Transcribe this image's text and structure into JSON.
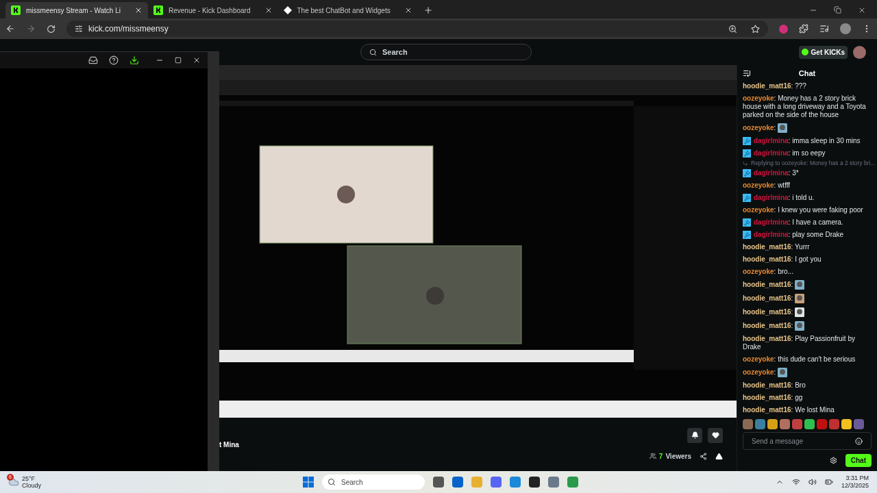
{
  "browser": {
    "tabs": [
      {
        "title": "missmeensy Stream - Watch Li",
        "selected": true
      },
      {
        "title": "Revenue - Kick Dashboard",
        "selected": false
      },
      {
        "title": "The best ChatBot and Widgets",
        "selected": false
      }
    ],
    "url": "kick.com/missmeensy"
  },
  "nav": {
    "search_placeholder": "Search",
    "get_kicks": "Get KICKs"
  },
  "stream": {
    "title_fragment": "t Mina",
    "viewers": {
      "count": "7",
      "label": "Viewers"
    }
  },
  "chat": {
    "title": "Chat",
    "messages": [
      {
        "user": "hoodie_matt16",
        "sep": ":",
        "color": "#e8c48a",
        "badge": false,
        "kind": "text",
        "text": "???"
      },
      {
        "user": "oozeyoke",
        "sep": ":",
        "color": "#e88a2e",
        "badge": false,
        "kind": "text",
        "text": "Money has a 2 story brick house with a long driveway and a Toyota parked on the side of the house"
      },
      {
        "user": "oozeyoke",
        "sep": ":",
        "color": "#e88a2e",
        "badge": false,
        "kind": "emote"
      },
      {
        "user": "dagirlmina",
        "sep": ":",
        "color": "#d0143c",
        "badge": true,
        "kind": "text",
        "text": "imma sleep in 30 mins"
      },
      {
        "user": "dagirlmina",
        "sep": ":",
        "color": "#d0143c",
        "badge": true,
        "kind": "text",
        "text": "im so eepy"
      },
      {
        "user": "dagirlmina",
        "sep": ":",
        "color": "#d0143c",
        "badge": true,
        "kind": "text",
        "text": "3*",
        "reply": "Replying to oozeyoke: Money has a 2 story bri..."
      },
      {
        "user": "oozeyoke",
        "sep": ":",
        "color": "#e88a2e",
        "badge": false,
        "kind": "text",
        "text": "wtfff"
      },
      {
        "user": "dagirlmina",
        "sep": ":",
        "color": "#d0143c",
        "badge": true,
        "kind": "text",
        "text": "i told u."
      },
      {
        "user": "oozeyoke",
        "sep": ":",
        "color": "#e88a2e",
        "badge": false,
        "kind": "text",
        "text": "I knew you were faking poor"
      },
      {
        "user": "dagirlmina",
        "sep": ":",
        "color": "#d0143c",
        "badge": true,
        "kind": "text",
        "text": "I have a camera."
      },
      {
        "user": "dagirlmina",
        "sep": ":",
        "color": "#d0143c",
        "badge": true,
        "kind": "text",
        "text": "play some Drake"
      },
      {
        "user": "hoodie_matt16",
        "sep": ":",
        "color": "#e8c48a",
        "badge": false,
        "kind": "text",
        "text": "Yurrr"
      },
      {
        "user": "hoodie_matt16",
        "sep": ":",
        "color": "#e8c48a",
        "badge": false,
        "kind": "text",
        "text": "I got you"
      },
      {
        "user": "oozeyoke",
        "sep": ":",
        "color": "#e88a2e",
        "badge": false,
        "kind": "text",
        "text": "bro..."
      },
      {
        "user": "hoodie_matt16",
        "sep": ":",
        "color": "#e8c48a",
        "badge": false,
        "kind": "emote"
      },
      {
        "user": "hoodie_matt16",
        "sep": ":",
        "color": "#e8c48a",
        "badge": false,
        "kind": "emote"
      },
      {
        "user": "hoodie_matt16",
        "sep": ":",
        "color": "#e8c48a",
        "badge": false,
        "kind": "emote"
      },
      {
        "user": "hoodie_matt16",
        "sep": ":",
        "color": "#e8c48a",
        "badge": false,
        "kind": "emote"
      },
      {
        "user": "hoodie_matt16",
        "sep": ":",
        "color": "#e8c48a",
        "badge": false,
        "kind": "text",
        "text": "Play Passionfruit by Drake"
      },
      {
        "user": "oozeyoke",
        "sep": ":",
        "color": "#e88a2e",
        "badge": false,
        "kind": "text",
        "text": "this dude can't be serious"
      },
      {
        "user": "oozeyoke",
        "sep": ":",
        "color": "#e88a2e",
        "badge": false,
        "kind": "emote"
      },
      {
        "user": "hoodie_matt16",
        "sep": ":",
        "color": "#e8c48a",
        "badge": false,
        "kind": "text",
        "text": "Bro"
      },
      {
        "user": "hoodie_matt16",
        "sep": ":",
        "color": "#e8c48a",
        "badge": false,
        "kind": "text",
        "text": "gg"
      },
      {
        "user": "hoodie_matt16",
        "sep": ":",
        "color": "#e8c48a",
        "badge": false,
        "kind": "text",
        "text": "We lost Mina"
      }
    ],
    "input_placeholder": "Send a message",
    "send": "Chat"
  },
  "taskbar": {
    "weather": {
      "temp": "25°F",
      "condition": "Cloudy",
      "badge": "6"
    },
    "search": "Search",
    "time": "3:31 PM",
    "date": "12/3/2025"
  }
}
